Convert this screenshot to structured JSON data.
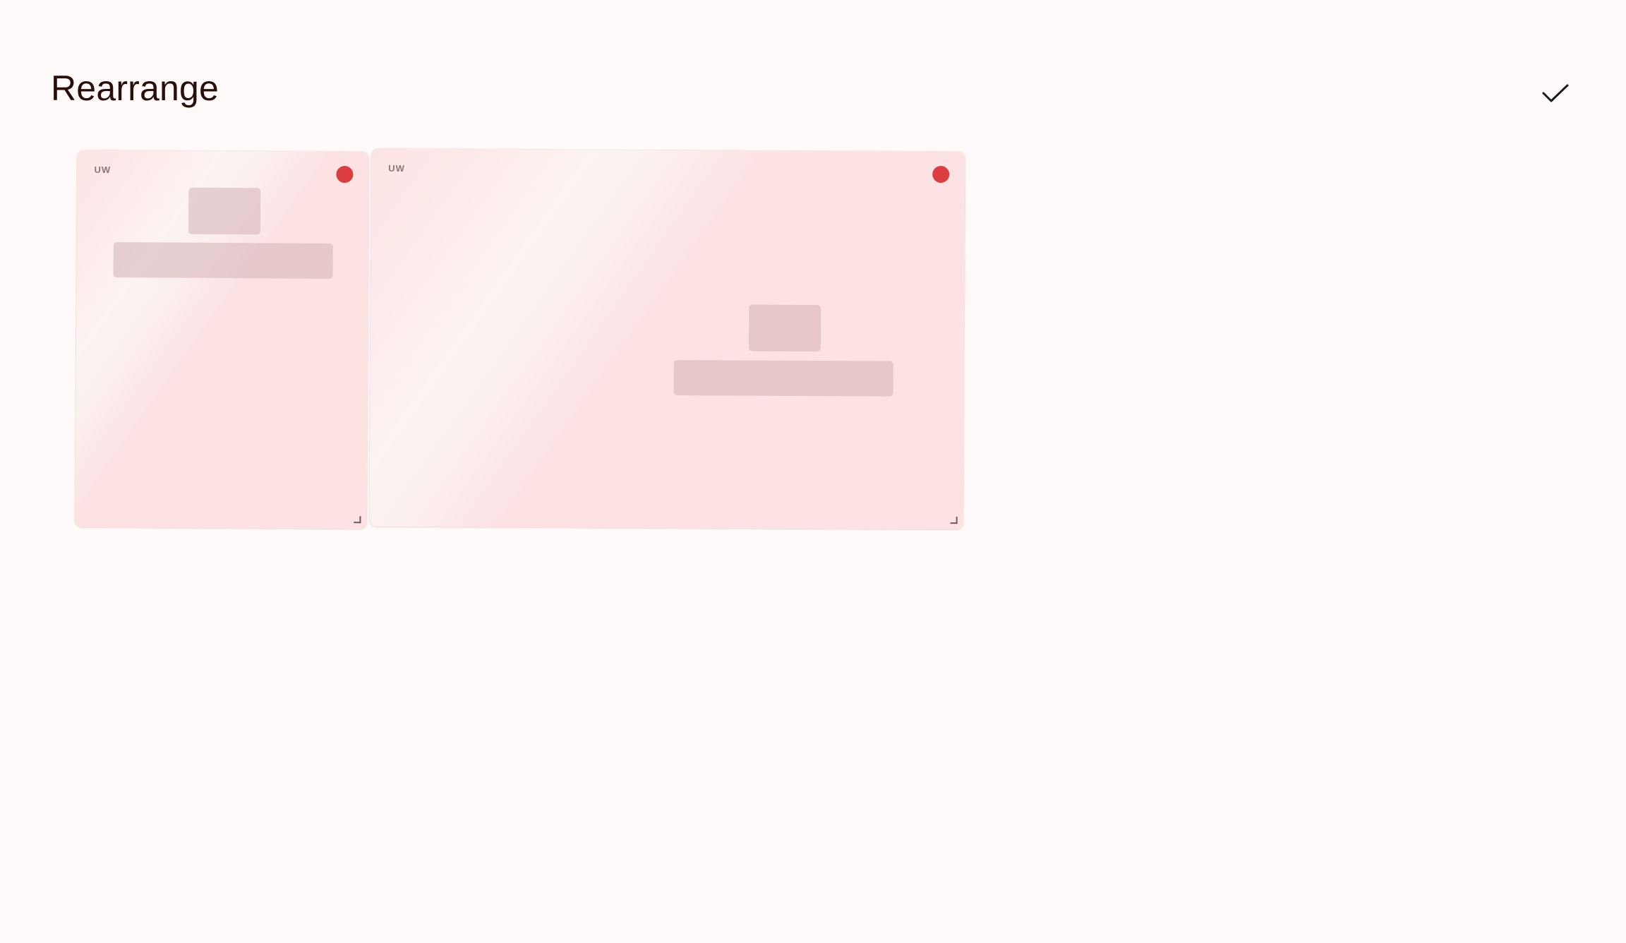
{
  "header": {
    "title": "Rearrange",
    "done_icon": "checkmark-icon"
  },
  "cards": [
    {
      "label": "UW",
      "remove_icon": "remove-dot-icon",
      "remove_color": "#dc3e40",
      "resize_icon": "resize-handle-icon"
    },
    {
      "label": "UW",
      "remove_icon": "remove-dot-icon",
      "remove_color": "#dc3e40",
      "resize_icon": "resize-handle-icon"
    }
  ],
  "colors": {
    "background": "#fffaf9",
    "title": "#2a0e0a",
    "card_tint": "#fde2e4",
    "skeleton": "#d4b2b6"
  }
}
